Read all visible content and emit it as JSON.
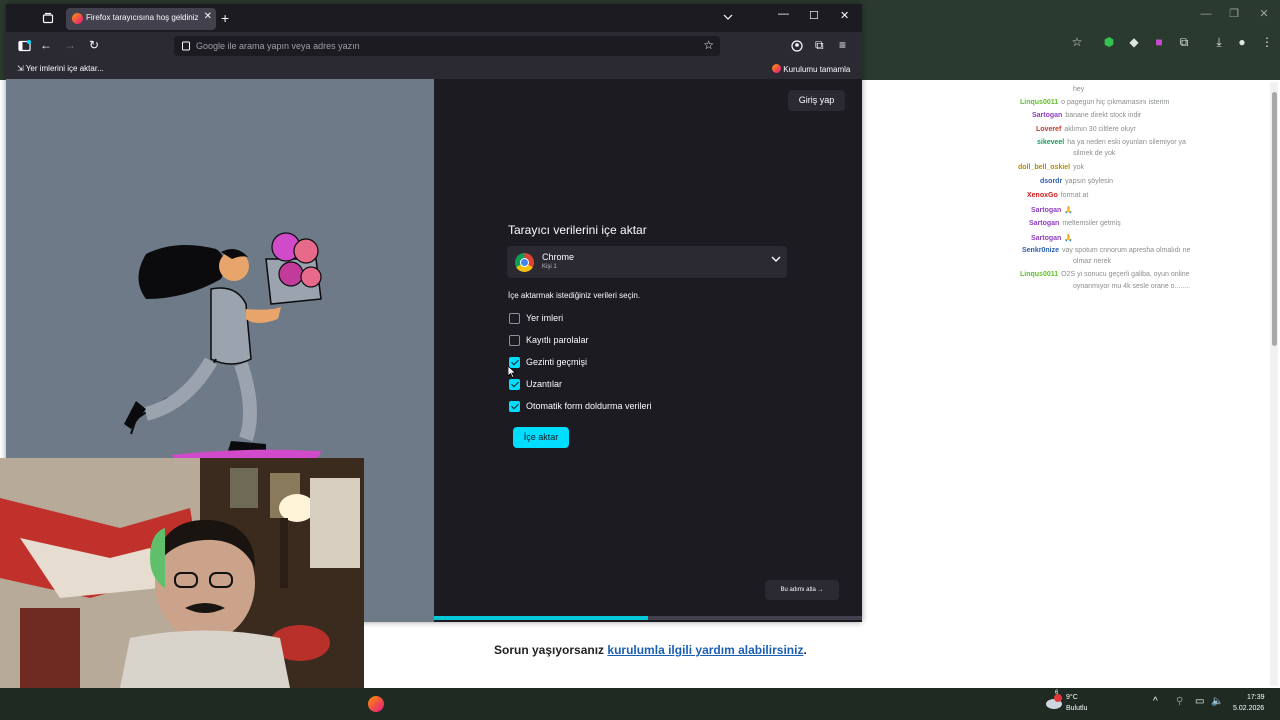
{
  "background": {
    "chat_messages": [
      {
        "user": "",
        "user_color": "#8a8f8a",
        "text": "hey"
      },
      {
        "user": "Linqus0011",
        "user_color": "#5fbf2a",
        "text": "o pagegun hiç çıkmamasını isterim"
      },
      {
        "user": "Sartogan",
        "user_color": "#8e3fbf",
        "text": "banane direkt stock indir"
      },
      {
        "user": "Loveref",
        "user_color": "#c0392b",
        "text": "aklımın 30 ciltlere oluyr"
      },
      {
        "user": "sikeveel",
        "user_color": "#1a9c5b",
        "text": "ha ya neden eski oyunları silemiyor ya"
      },
      {
        "user": "",
        "user_color": "#8a8f8a",
        "text": "silmek de yok"
      },
      {
        "user": "doll_bell_oskiel",
        "user_color": "#b58b00",
        "text": "yok"
      },
      {
        "user": "dsordr",
        "user_color": "#2d5fb0",
        "text": "yapsın şöylesin"
      },
      {
        "user": "XenoxGo",
        "user_color": "#d31b1b",
        "text": "format at"
      },
      {
        "user": "Sartogan",
        "user_color": "#8e3fbf",
        "text": "🙏"
      },
      {
        "user": "Sartogan",
        "user_color": "#8e3fbf",
        "text": "meltemsiler getmiş"
      },
      {
        "user": "Sartogan",
        "user_color": "#8e3fbf",
        "text": "🙏"
      },
      {
        "user": "Senkr0nize",
        "user_color": "#2d5fb0",
        "text": "vay spotum cnnorum apresha olmalıdı ne"
      },
      {
        "user": "",
        "user_color": "#8a8f8a",
        "text": "olmaz nerek"
      },
      {
        "user": "Linqus0011",
        "user_color": "#5fbf2a",
        "text": "O2S yi sonucu geçerli galiba, oyun online"
      },
      {
        "user": "",
        "user_color": "#8a8f8a",
        "text": "oynanmıyor mu 4k sesle orane o........"
      }
    ],
    "help_text": "Sorun yaşıyorsanız",
    "help_link": "kurulumla ilgili yardım alabilirsiniz",
    "help_suffix": "."
  },
  "firefox": {
    "tab_title": "Firefox tarayıcısına hoş geldiniz",
    "url_placeholder": "Google ile arama yapın veya adres yazın",
    "bookmarks": {
      "left": "Yer imlerini içe aktar...",
      "right": "Kurulumu tamamla"
    },
    "signin": "Giriş yap",
    "import_title": "Tarayıcı verilerini içe aktar",
    "browser": {
      "name": "Chrome",
      "profile": "Kişi 1"
    },
    "description": "İçe aktarmak istediğiniz verileri seçin.",
    "options": [
      {
        "label": "Yer imleri",
        "checked": false
      },
      {
        "label": "Kayıtlı parolalar",
        "checked": false
      },
      {
        "label": "Gezinti geçmişi",
        "checked": true
      },
      {
        "label": "Uzantılar",
        "checked": true
      },
      {
        "label": "Otomatik form doldurma verileri",
        "checked": true
      }
    ],
    "import_button": "İçe aktar",
    "skip_button": "Bu adımı atla",
    "progress": 0.5,
    "colors": {
      "accent": "#00ddff",
      "panel": "#1c1b22",
      "illustration_bg": "#6e7a87"
    }
  },
  "taskbar": {
    "weather_temp": "9°C",
    "weather_desc": "Bulutlu",
    "weather_badge": "6",
    "time": "17:39",
    "date": "5.02.2026"
  }
}
